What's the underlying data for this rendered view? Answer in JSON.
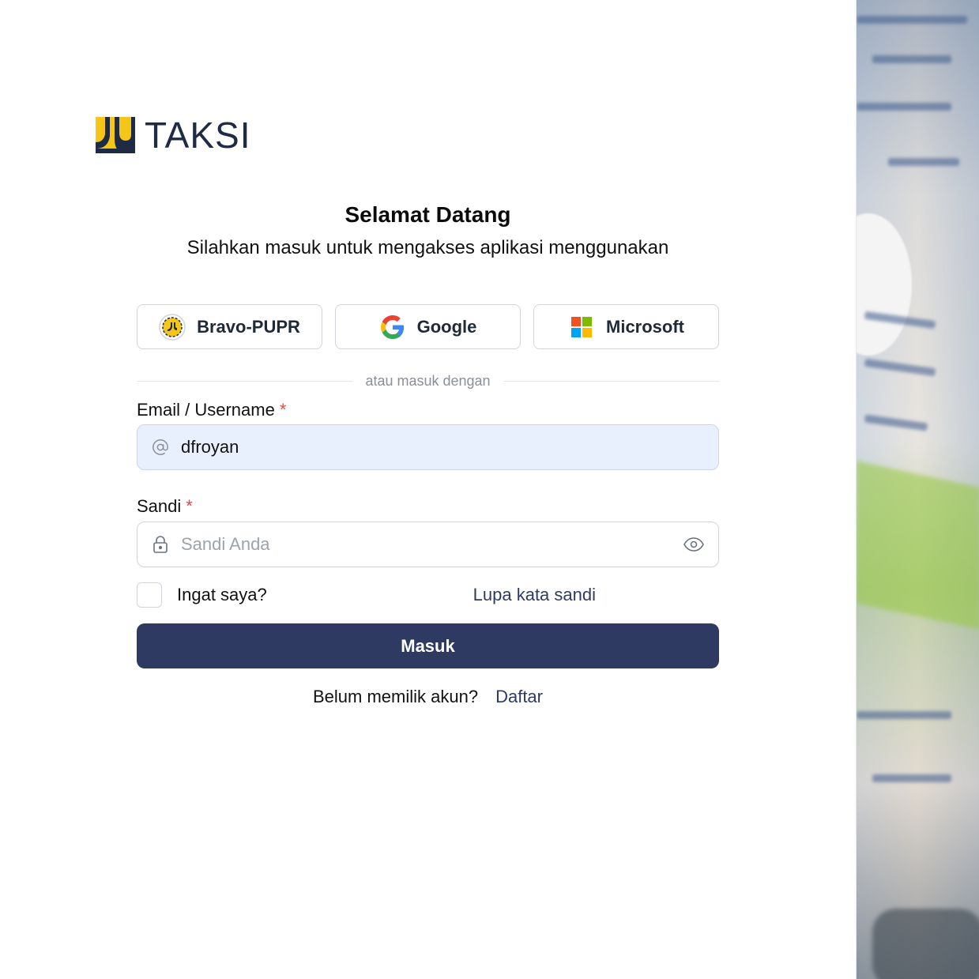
{
  "brand": {
    "name": "TAKSI",
    "colors": {
      "yellow": "#f5c518",
      "navy": "#1f2a44"
    }
  },
  "header": {
    "title": "Selamat Datang",
    "subtitle": "Silahkan masuk untuk mengakses aplikasi menggunakan"
  },
  "providers": [
    {
      "label": "Bravo-PUPR",
      "icon": "bravo-pupr-logo-icon"
    },
    {
      "label": "Google",
      "icon": "google-logo-icon"
    },
    {
      "label": "Microsoft",
      "icon": "microsoft-logo-icon"
    }
  ],
  "divider": {
    "text": "atau masuk dengan"
  },
  "form": {
    "email": {
      "label": "Email / Username",
      "required_mark": "*",
      "value": "dfroyan",
      "icon": "at-sign-icon"
    },
    "password": {
      "label": "Sandi",
      "required_mark": "*",
      "value": "",
      "placeholder": "Sandi Anda",
      "icon": "lock-icon",
      "toggle_icon": "eye-icon"
    },
    "remember": {
      "label": "Ingat saya?",
      "checked": false
    },
    "forgot_label": "Lupa kata sandi",
    "submit_label": "Masuk"
  },
  "signup": {
    "prompt": "Belum memilik akun?",
    "link": "Daftar"
  },
  "accent_color": "#2f3a63"
}
